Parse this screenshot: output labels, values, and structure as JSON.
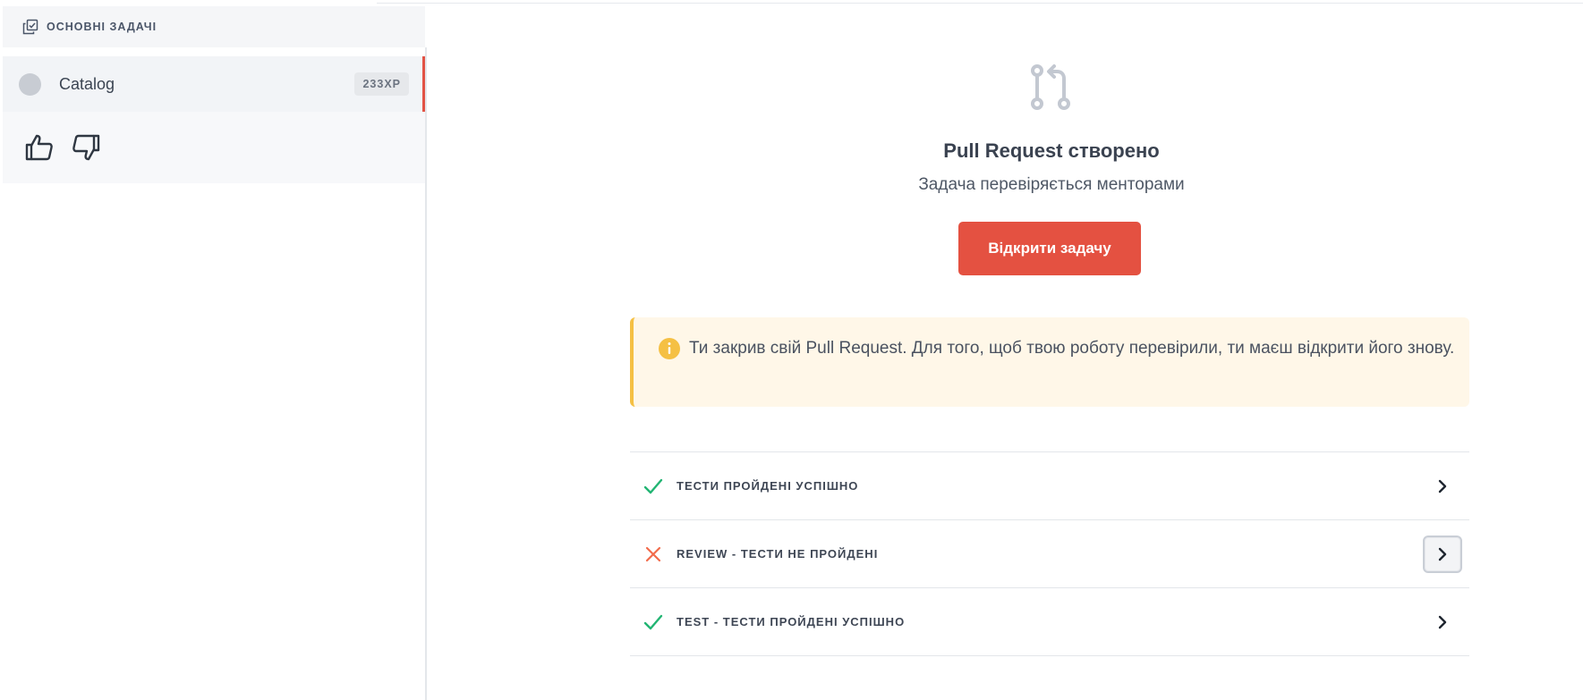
{
  "sidebar": {
    "section_title": "ОСНОВНІ ЗАДАЧІ",
    "task": {
      "name": "Catalog",
      "xp": "233XP"
    },
    "feedback": {
      "like_icon": "thumbs-up-icon",
      "dislike_icon": "thumbs-down-icon"
    }
  },
  "main": {
    "status_icon": "git-pull-request-icon",
    "title": "Pull Request створено",
    "subtitle": "Задача перевіряється менторами",
    "open_button": "Відкрити задачу",
    "alert": {
      "icon": "info-icon",
      "text": "Ти закрив свій Pull Request. Для того, щоб твою роботу перевірили, ти маєш відкрити його знову."
    },
    "checks": [
      {
        "label": "ТЕСТИ ПРОЙДЕНІ УСПІШНО",
        "status": "passed"
      },
      {
        "label": "REVIEW - ТЕСТИ НЕ ПРОЙДЕНІ",
        "status": "failed"
      },
      {
        "label": "TEST - ТЕСТИ ПРОЙДЕНІ УСПІШНО",
        "status": "passed"
      }
    ]
  },
  "colors": {
    "accent": "#e45141",
    "passed": "#22b573",
    "failed": "#f26b4b",
    "warning": "#f5c044",
    "alert_bg": "#fff7e8"
  }
}
